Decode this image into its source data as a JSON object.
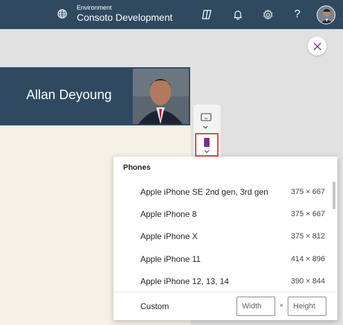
{
  "header": {
    "environment_label": "Environment",
    "environment_name": "Consoto Development",
    "icons": [
      "environment-icon",
      "copilot-icon",
      "bell-icon",
      "gear-icon",
      "help-icon",
      "avatar"
    ],
    "help_glyph": "?",
    "color": "#2f4a60"
  },
  "profile": {
    "name": "Allan Deyoung"
  },
  "device_toolbar": {
    "selected": "phone",
    "highlight_color": "#e0484a"
  },
  "phones_menu": {
    "heading": "Phones",
    "items": [
      {
        "name": "Apple iPhone SE 2nd gen, 3rd gen",
        "size": "375 × 667"
      },
      {
        "name": "Apple iPhone 8",
        "size": "375 × 667"
      },
      {
        "name": "Apple iPhone X",
        "size": "375 × 812"
      },
      {
        "name": "Apple iPhone 11",
        "size": "414 × 896"
      },
      {
        "name": "Apple iPhone 12, 13, 14",
        "size": "390 × 844"
      }
    ],
    "custom_label": "Custom",
    "width_placeholder": "Width",
    "height_placeholder": "Height",
    "times": "×"
  }
}
